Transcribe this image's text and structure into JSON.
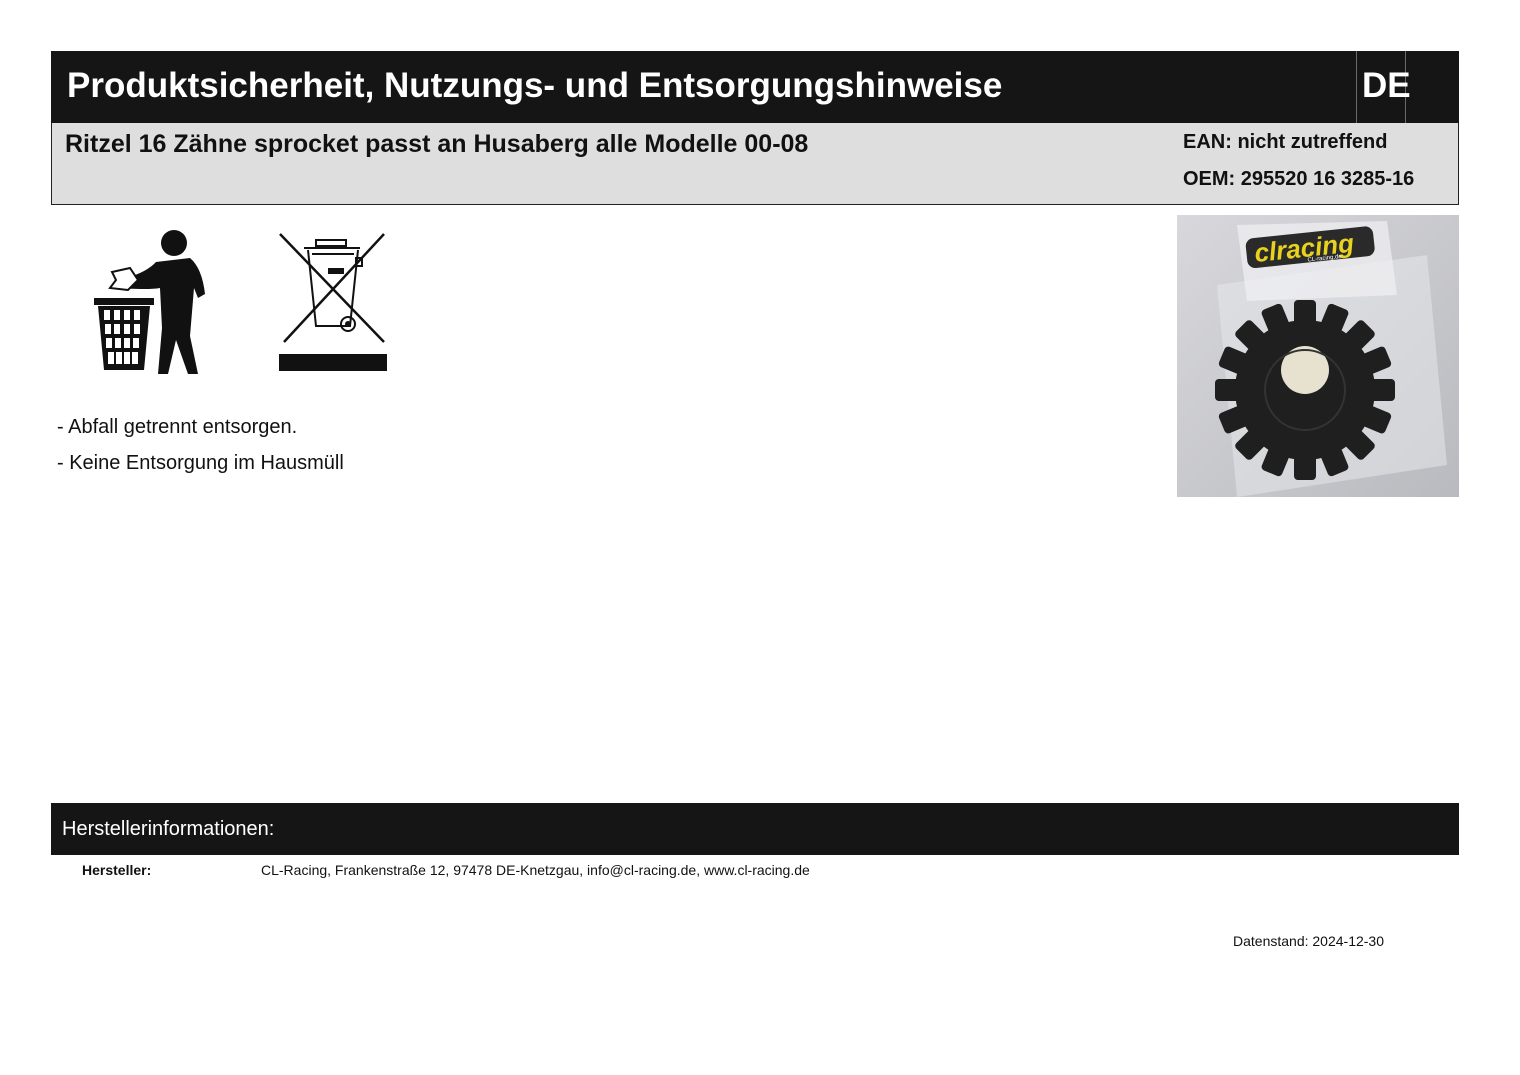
{
  "header": {
    "title": "Produktsicherheit, Nutzungs- und Entsorgungshinweise",
    "language": "DE"
  },
  "product": {
    "title": "Ritzel 16 Zähne sprocket passt an Husaberg alle Modelle 00-08",
    "ean": "EAN: nicht zutreffend",
    "oem": "OEM: 295520 16 3285-16"
  },
  "icons": {
    "disposal_person": "person-trash-bin-icon",
    "weee": "crossed-out-wheelie-bin-icon"
  },
  "notes": [
    "- Abfall getrennt entsorgen.",
    "- Keine Entsorgung im Hausmüll"
  ],
  "photo": {
    "logo_text": "clracing",
    "logo_subtext": "CL-racing.de"
  },
  "manufacturer": {
    "section_title": "Herstellerinformationen:",
    "label": "Hersteller:",
    "value": "CL-Racing, Frankenstraße 12, 97478 DE-Knetzgau, info@cl-racing.de, www.cl-racing.de"
  },
  "footer": {
    "date_label": "Datenstand:",
    "date_value": "2024-12-30"
  },
  "colors": {
    "header_bg": "#151515",
    "subheader_bg": "#dedede",
    "logo_yellow": "#e8d21e"
  }
}
